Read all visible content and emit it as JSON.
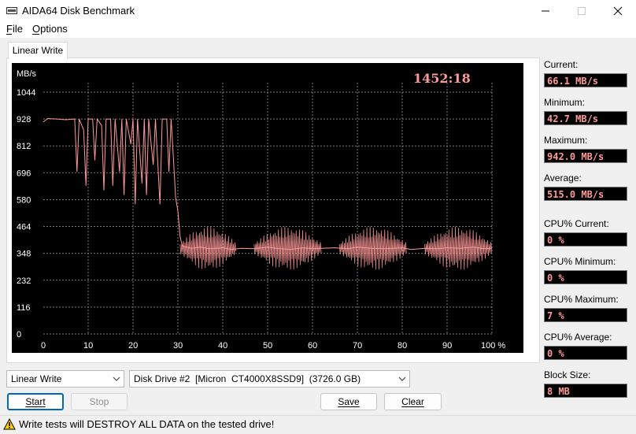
{
  "window": {
    "title": "AIDA64 Disk Benchmark"
  },
  "menu": {
    "file": "File",
    "options": "Options"
  },
  "tab": {
    "label": "Linear Write"
  },
  "chart_data": {
    "type": "line",
    "title": "",
    "ylabel": "MB/s",
    "xlabel": "",
    "timer": "1452:18",
    "yticks": [
      "1044",
      "928",
      "812",
      "696",
      "580",
      "464",
      "348",
      "232",
      "116",
      "0"
    ],
    "xticks": [
      "0",
      "10",
      "20",
      "30",
      "40",
      "50",
      "60",
      "70",
      "80",
      "90",
      "100 %"
    ],
    "ylim": [
      0,
      1160
    ],
    "xlim": [
      0,
      100
    ],
    "grid": true,
    "line_color": "#ff9999",
    "series": [
      {
        "values": [
          [
            0,
            915
          ],
          [
            1,
            930
          ],
          [
            3,
            928
          ],
          [
            5,
            925
          ],
          [
            7,
            928
          ],
          [
            7.5,
            700
          ],
          [
            8,
            928
          ],
          [
            9,
            880
          ],
          [
            9.5,
            640
          ],
          [
            10,
            928
          ],
          [
            11,
            928
          ],
          [
            11.5,
            750
          ],
          [
            12,
            928
          ],
          [
            13,
            900
          ],
          [
            13.5,
            620
          ],
          [
            14,
            928
          ],
          [
            15,
            928
          ],
          [
            15.5,
            640
          ],
          [
            16,
            928
          ],
          [
            17,
            700
          ],
          [
            17.5,
            928
          ],
          [
            18,
            600
          ],
          [
            18.5,
            928
          ],
          [
            19.5,
            820
          ],
          [
            20,
            928
          ],
          [
            20.5,
            560
          ],
          [
            21,
            928
          ],
          [
            22,
            650
          ],
          [
            22.5,
            928
          ],
          [
            23,
            600
          ],
          [
            23.5,
            928
          ],
          [
            24.5,
            730
          ],
          [
            25,
            928
          ],
          [
            26,
            560
          ],
          [
            26.5,
            928
          ],
          [
            27.5,
            928
          ],
          [
            28,
            700
          ],
          [
            28.5,
            928
          ],
          [
            29,
            760
          ],
          [
            29.5,
            590
          ],
          [
            30,
            530
          ],
          [
            30.5,
            420
          ],
          [
            31,
            380
          ],
          [
            33,
            370
          ],
          [
            35,
            375
          ],
          [
            37,
            368
          ],
          [
            40,
            372
          ],
          [
            42,
            365
          ],
          [
            44,
            370
          ],
          [
            47,
            368
          ],
          [
            50,
            375
          ],
          [
            52,
            370
          ],
          [
            55,
            365
          ],
          [
            58,
            372
          ],
          [
            60,
            368
          ],
          [
            62,
            370
          ],
          [
            65,
            372
          ],
          [
            68,
            368
          ],
          [
            70,
            375
          ],
          [
            73,
            370
          ],
          [
            76,
            368
          ],
          [
            80,
            372
          ],
          [
            82,
            365
          ],
          [
            85,
            370
          ],
          [
            88,
            368
          ],
          [
            90,
            372
          ],
          [
            93,
            370
          ],
          [
            96,
            375
          ],
          [
            98,
            368
          ],
          [
            100,
            370
          ]
        ]
      }
    ],
    "oscillation_bands": [
      {
        "from": 30.5,
        "to": 43,
        "peak_amplitude": 95
      },
      {
        "from": 47,
        "to": 62,
        "peak_amplitude": 95
      },
      {
        "from": 66,
        "to": 81,
        "peak_amplitude": 95
      },
      {
        "from": 85,
        "to": 100,
        "peak_amplitude": 95
      }
    ]
  },
  "stats": {
    "current_label": "Current:",
    "current_value": "66.1 MB/s",
    "minimum_label": "Minimum:",
    "minimum_value": "42.7 MB/s",
    "maximum_label": "Maximum:",
    "maximum_value": "942.0 MB/s",
    "average_label": "Average:",
    "average_value": "515.0 MB/s",
    "cpu_current_label": "CPU% Current:",
    "cpu_current_value": "0 %",
    "cpu_minimum_label": "CPU% Minimum:",
    "cpu_minimum_value": "0 %",
    "cpu_maximum_label": "CPU% Maximum:",
    "cpu_maximum_value": "7 %",
    "cpu_average_label": "CPU% Average:",
    "cpu_average_value": "0 %",
    "block_size_label": "Block Size:",
    "block_size_value": "8 MB"
  },
  "controls": {
    "test_select": "Linear Write",
    "drive_select": "Disk Drive #2  [Micron  CT4000X8SSD9]  (3726.0 GB)",
    "start": "Start",
    "stop": "Stop",
    "save": "Save",
    "clear": "Clear"
  },
  "status": {
    "warning": "Write tests will DESTROY ALL DATA on the tested drive!"
  },
  "colors": {
    "accent": "#0067c0",
    "value_text": "#ff9999",
    "chart_bg": "#000000",
    "grid": "#808080"
  }
}
